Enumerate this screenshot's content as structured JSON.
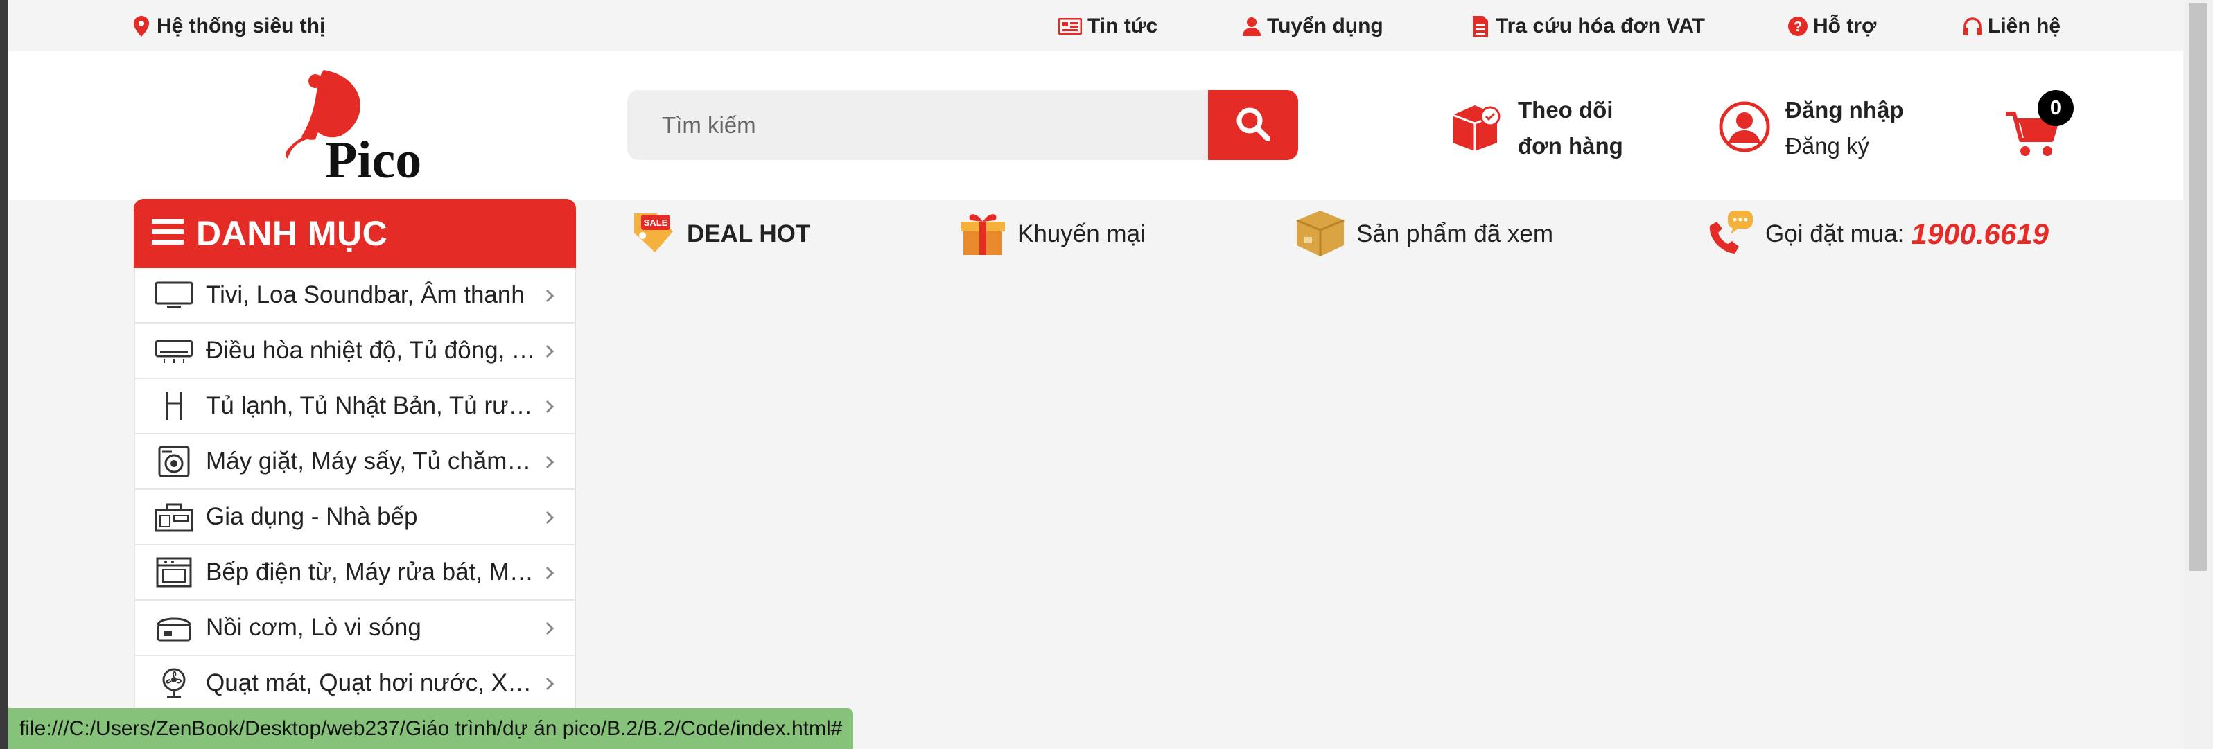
{
  "topbar": {
    "store_system": "Hệ thống siêu thị",
    "news": "Tin tức",
    "recruitment": "Tuyển dụng",
    "vat_lookup": "Tra cứu hóa đơn VAT",
    "support": "Hỗ trợ",
    "contact": "Liên hệ"
  },
  "header": {
    "logo_text": "Pico",
    "search": {
      "placeholder": "Tìm kiếm",
      "value": ""
    },
    "track_order": {
      "line1": "Theo dõi",
      "line2": "đơn hàng"
    },
    "account": {
      "login": "Đăng nhập",
      "register": "Đăng ký"
    },
    "cart_count": "0"
  },
  "nav": {
    "category_title": "DANH MỤC",
    "deal_hot": "DEAL HOT",
    "promotion": "Khuyến mại",
    "viewed": "Sản phẩm đã xem",
    "hotline_label": "Gọi đặt mua:",
    "hotline_number": "1900.6619"
  },
  "categories": [
    {
      "label": "Tivi, Loa Soundbar, Âm thanh",
      "icon": "tv-icon"
    },
    {
      "label": "Điều hòa nhiệt độ, Tủ đông, Tủ mát",
      "icon": "air-conditioner-icon"
    },
    {
      "label": "Tủ lạnh, Tủ Nhật Bản, Tủ rượu",
      "icon": "fridge-icon"
    },
    {
      "label": "Máy giặt, Máy sấy, Tủ chăm sóc quần áo",
      "icon": "washing-machine-icon"
    },
    {
      "label": "Gia dụng - Nhà bếp",
      "icon": "kitchen-icon"
    },
    {
      "label": "Bếp điện từ, Máy rửa bát, Máy hút mùi",
      "icon": "stove-icon"
    },
    {
      "label": "Nồi cơm, Lò vi sóng",
      "icon": "rice-cooker-icon"
    },
    {
      "label": "Quạt mát, Quạt hơi nước, Xe đạp",
      "icon": "fan-icon"
    }
  ],
  "status_bar": {
    "url": "file:///C:/Users/ZenBook/Desktop/web237/Giáo trình/dự án pico/B.2/B.2/Code/index.html#"
  },
  "colors": {
    "brand_red": "#e52b25",
    "page_bg": "#f4f4f4",
    "status_green": "#86c27a"
  }
}
